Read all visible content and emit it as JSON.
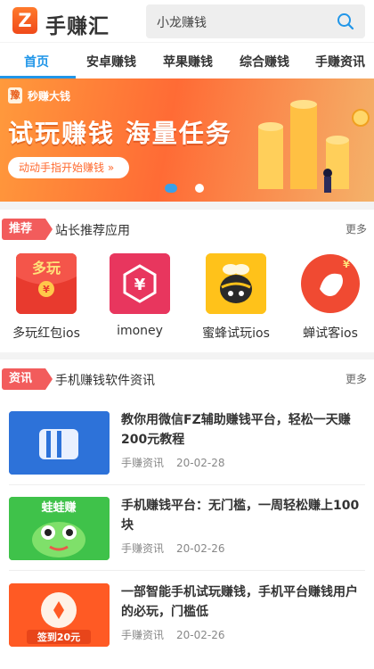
{
  "header": {
    "logo_letter": "Z",
    "app_name": "手赚汇",
    "search_text": "小龙赚钱",
    "search_icon": "search-icon"
  },
  "tabs": [
    {
      "label": "首页",
      "active": true
    },
    {
      "label": "安卓赚钱",
      "active": false
    },
    {
      "label": "苹果赚钱",
      "active": false
    },
    {
      "label": "综合赚钱",
      "active": false
    },
    {
      "label": "手赚资讯",
      "active": false
    }
  ],
  "banner": {
    "logo_char": "豫",
    "brand": "秒赚大钱",
    "headline": "试玩赚钱 海量任务",
    "cta": "动动手指开始赚钱 »",
    "active_slide": 1,
    "slide_count": 2
  },
  "recommend": {
    "tag": "推荐",
    "title": "站长推荐应用",
    "more": "更多",
    "apps": [
      {
        "label": "多玩红包ios",
        "icon": "duowan-hongbao-icon"
      },
      {
        "label": "imoney",
        "icon": "imoney-icon"
      },
      {
        "label": "蜜蜂试玩ios",
        "icon": "bee-icon"
      },
      {
        "label": "蝉试客ios",
        "icon": "cicada-icon"
      }
    ]
  },
  "news": {
    "tag": "资讯",
    "title": "手机赚钱软件资讯",
    "more": "更多",
    "items": [
      {
        "title": "教你用微信FZ辅助赚钱平台，轻松一天赚200元教程",
        "source": "手赚资讯",
        "date": "20-02-28",
        "thumb_text": ""
      },
      {
        "title": "手机赚钱平台：无门槛，一周轻松赚上100块",
        "source": "手赚资讯",
        "date": "20-02-26",
        "thumb_text": "蛙蛙赚"
      },
      {
        "title": "一部智能手机试玩赚钱，手机平台赚钱用户的必玩，门槛低",
        "source": "手赚资讯",
        "date": "20-02-26",
        "thumb_text": "签到20元"
      }
    ]
  },
  "colors": {
    "accent": "#2196e8",
    "tag_red": "#f25c5c",
    "banner_orange": "#ff6b35"
  }
}
